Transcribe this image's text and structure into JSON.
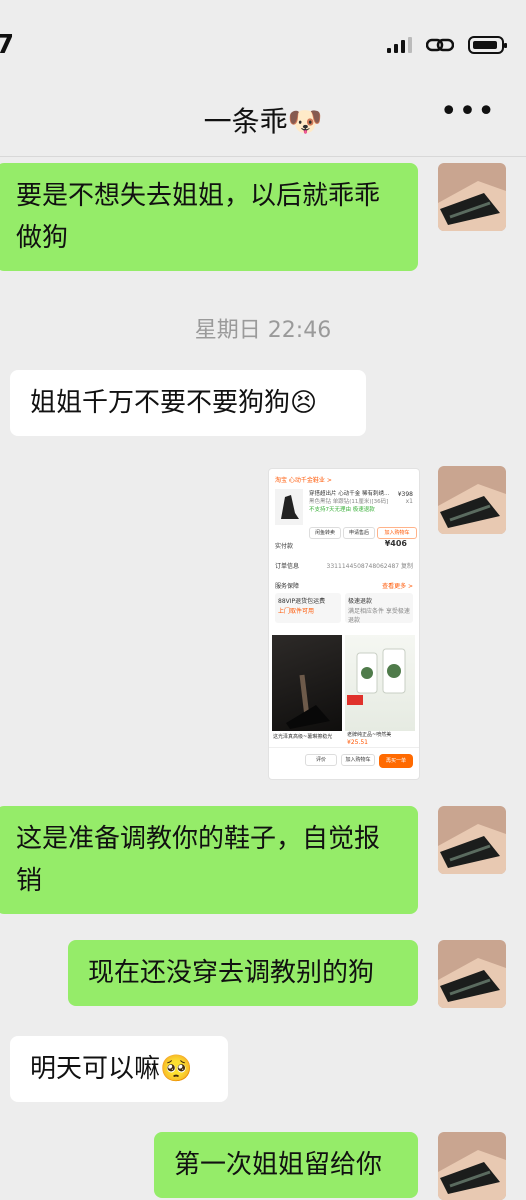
{
  "status_bar": {
    "time": "7"
  },
  "nav": {
    "title": "一条乖🐶",
    "more": "•••"
  },
  "messages": [
    {
      "text": "要是不想失去姐姐，以后就乖乖做狗"
    },
    {
      "text": "姐姐千万不要不要狗狗😣"
    },
    {
      "text": "这是准备调教你的鞋子，自觉报销"
    },
    {
      "text": "现在还没穿去调教别的狗"
    },
    {
      "text": "明天可以嘛🥺"
    },
    {
      "text": "第一次姐姐留给你"
    }
  ],
  "time_separator": "星期日 22:46",
  "taobao_card": {
    "store": "淘宝 心动千金鞋业 >",
    "product_name": "穿搭超出片 心动千金 稀有刺绣…",
    "product_spec": "黑色黑钻 单跟钻(11厘米)[36码]",
    "product_note": "不支持7天无理由 极速退款",
    "price": "¥398",
    "qty": "x1",
    "btn_refund": "闲鱼转卖",
    "btn_after": "申请售后",
    "btn_cart": "加入购物车",
    "paid_label": "实付款",
    "paid_value": "¥406",
    "order_label": "订单信息",
    "order_no": "3311144508748062487 复制",
    "service_label": "服务保障",
    "service_more": "查看更多 >",
    "vip_title": "88VIP退货包运费",
    "vip_sub": "上门取件可用",
    "refund_title": "极速退款",
    "refund_sub": "满足相应条件 享受极速退款",
    "bottom_eval": "评价",
    "bottom_cart": "加入购物车",
    "bottom_buy": "再买一单",
    "ad1_caption": "这光泽真高级~薯琳擦稳光",
    "ad2_caption": "老牌纯正品~喷然美",
    "ad2_price": "¥25.51"
  }
}
